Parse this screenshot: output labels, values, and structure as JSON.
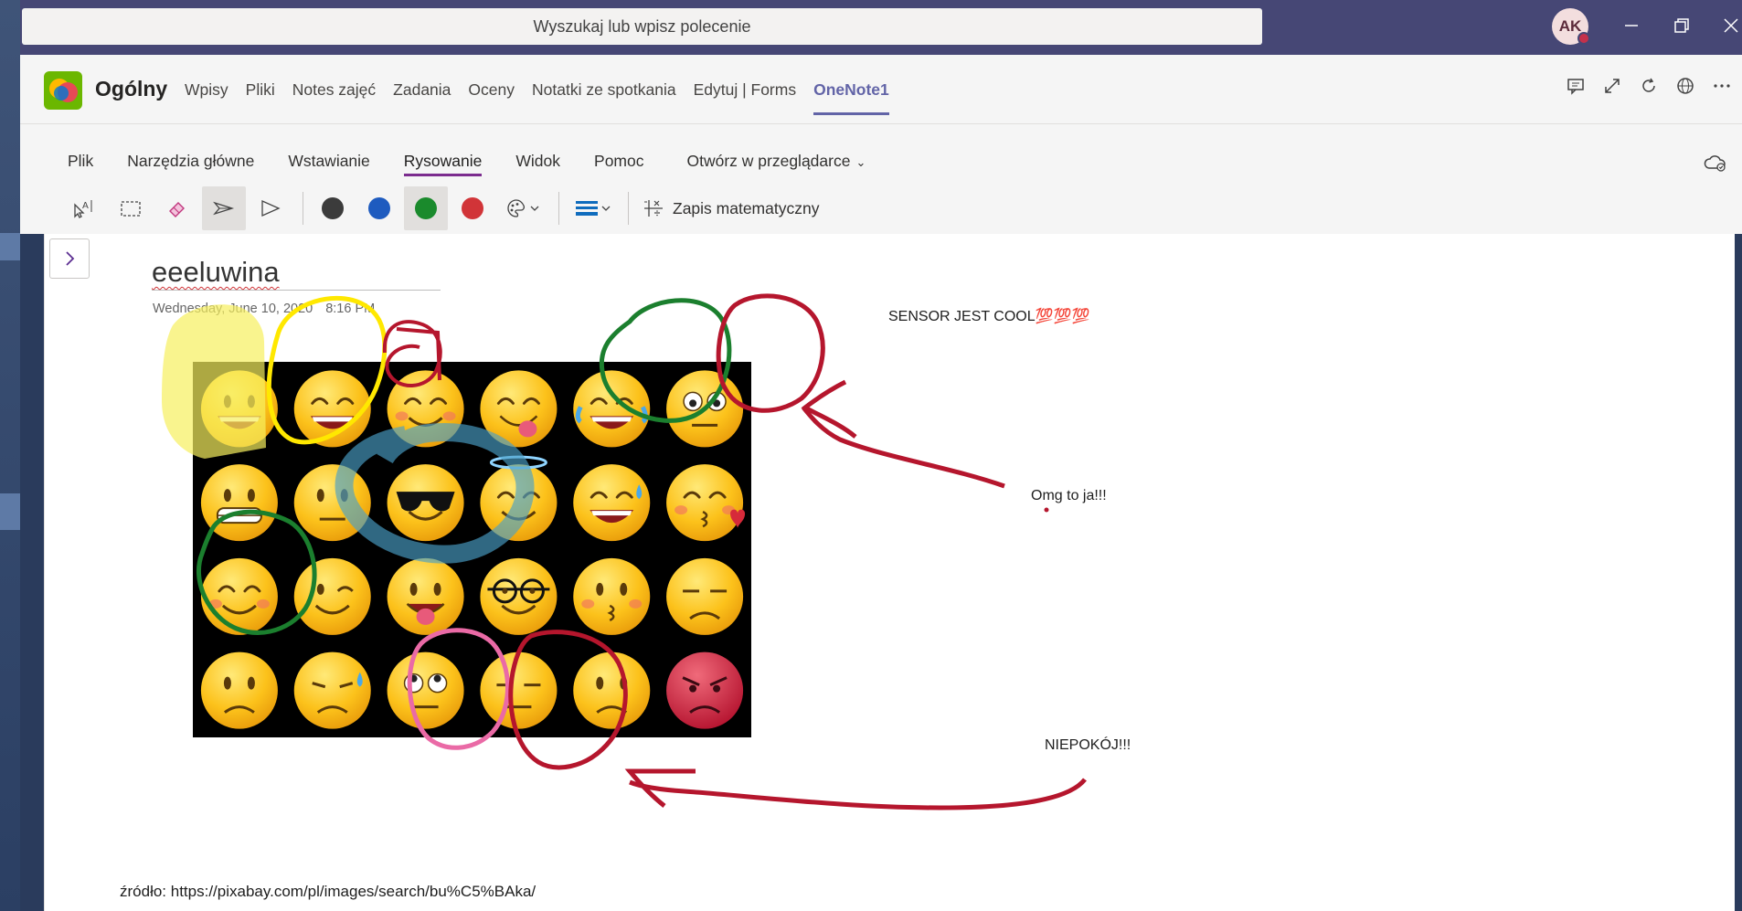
{
  "search": {
    "placeholder": "Wyszukaj lub wpisz polecenie"
  },
  "user": {
    "initials": "AK",
    "status": "busy"
  },
  "channel": {
    "title": "Ogólny",
    "tabs": [
      "Wpisy",
      "Pliki",
      "Notes zajęć",
      "Zadania",
      "Oceny",
      "Notatki ze spotkania",
      "Edytuj | Forms",
      "OneNote1"
    ],
    "active_tab": "OneNote1"
  },
  "ribbon": {
    "menu": [
      "Plik",
      "Narzędzia główne",
      "Wstawianie",
      "Rysowanie",
      "Widok",
      "Pomoc"
    ],
    "active_menu": "Rysowanie",
    "open_in_browser": "Otwórz w przeglądarce",
    "math_label": "Zapis matematyczny",
    "pen_colors": [
      "#3b3b3b",
      "#1e5bbf",
      "#1a8a2c",
      "#d13438"
    ],
    "selected_pen": "#1a8a2c"
  },
  "page": {
    "title": "eeeluwina",
    "date": "Wednesday, June 10, 2020",
    "time": "8:16 PM",
    "note_sensor": "SENSOR JEST COOL💯💯💯",
    "note_omg": "Omg to ja!!!",
    "note_niepokoj": "NIEPOKÓJ!!!",
    "source": "źródło: https://pixabay.com/pl/images/search/bu%C5%BAka/"
  },
  "emoji_grid": {
    "columns": 6,
    "rows": 4,
    "faces": [
      "grinning",
      "smile",
      "smiling-eyes",
      "yum",
      "joy",
      "flushed",
      "grimacing",
      "neutral",
      "sunglasses",
      "innocent",
      "sweat-smile",
      "kissing-heart",
      "blush-closed",
      "wink",
      "tongue",
      "nerd",
      "kissing",
      "pensive",
      "confused",
      "crying",
      "eye-roll",
      "expressionless",
      "frowning",
      "angry"
    ]
  },
  "ink_colors": {
    "highlighter": "#f7ef5e",
    "yellow": "#ffe800",
    "red": "#b5162d",
    "green": "#1b7f2e",
    "blue": "#4aa0c8",
    "pink": "#ea6aa6"
  }
}
